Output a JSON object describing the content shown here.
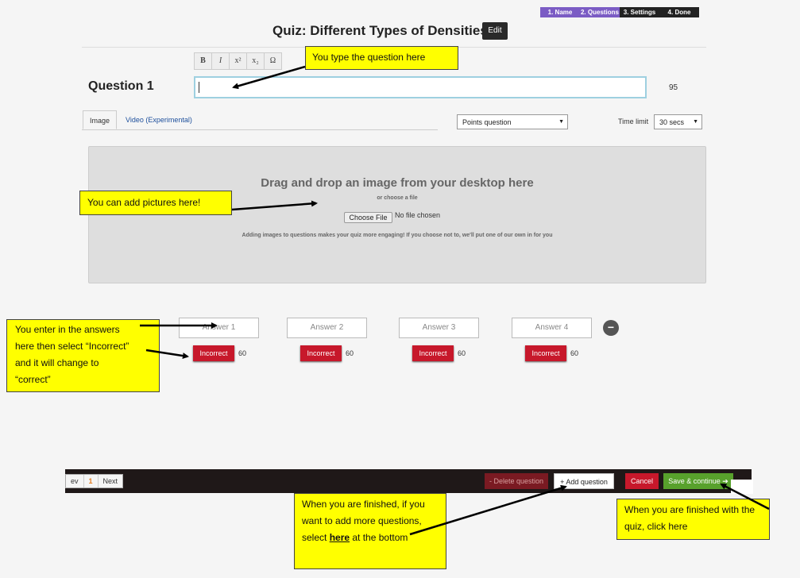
{
  "steps": [
    "1. Name",
    "2. Questions",
    "3. Settings",
    "4. Done"
  ],
  "header": {
    "title": "Quiz: Different Types of Densities",
    "edit_label": "Edit"
  },
  "format_bar": [
    "B",
    "I",
    "x²",
    "x₂",
    "Ω"
  ],
  "question": {
    "label": "Question 1",
    "value": "",
    "char_count": "95"
  },
  "media_tabs": {
    "image": "Image",
    "video": "Video (Experimental)"
  },
  "question_type": {
    "selected": "Points question"
  },
  "time_limit": {
    "label": "Time limit",
    "selected": "30 secs"
  },
  "dropzone": {
    "title": "Drag and drop an image from your desktop here",
    "or_choose": "or choose a file",
    "choose_label": "Choose File",
    "no_file": "No file chosen",
    "hint": "Adding images to questions makes your quiz more engaging! If you choose not to, we'll put one of our own in for you"
  },
  "answers": [
    {
      "placeholder": "Answer 1",
      "status": "Incorrect",
      "points": "60"
    },
    {
      "placeholder": "Answer 2",
      "status": "Incorrect",
      "points": "60"
    },
    {
      "placeholder": "Answer 3",
      "status": "Incorrect",
      "points": "60"
    },
    {
      "placeholder": "Answer 4",
      "status": "Incorrect",
      "points": "60"
    }
  ],
  "remove_answer_icon": "minus-circle-icon",
  "pagination": {
    "prev": "ev",
    "current": "1",
    "next": "Next"
  },
  "actions": {
    "delete": "- Delete question",
    "add": "+ Add question",
    "cancel": "Cancel",
    "save": "Save & continue ➔"
  },
  "callouts": {
    "question": "You type the question here",
    "pictures": "You can add pictures here!",
    "answers": [
      "You enter in the answers",
      "here then select “Incorrect”",
      "and it will change to",
      "“correct”"
    ],
    "add_more_pre": "When you are finished, if you want to add more questions, select ",
    "add_more_link": "here",
    "add_more_post": " at the bottom",
    "finish": "When you are finished with the quiz, click here"
  },
  "colors": {
    "callout": "#ffff00",
    "incorrect": "#c7182b",
    "save": "#58a12c",
    "step_active": "#7b5cc4"
  }
}
